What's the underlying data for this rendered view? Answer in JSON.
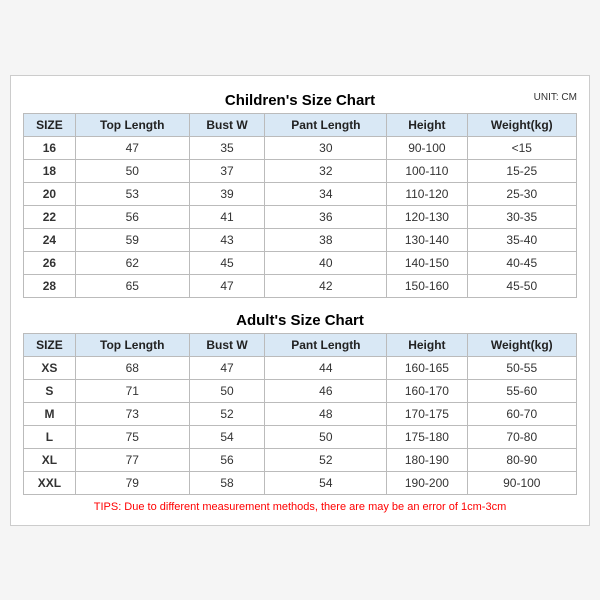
{
  "childrenChart": {
    "title": "Children's Size Chart",
    "unit": "UNIT: CM",
    "headers": [
      "SIZE",
      "Top Length",
      "Bust W",
      "Pant Length",
      "Height",
      "Weight(kg)"
    ],
    "rows": [
      [
        "16",
        "47",
        "35",
        "30",
        "90-100",
        "<15"
      ],
      [
        "18",
        "50",
        "37",
        "32",
        "100-110",
        "15-25"
      ],
      [
        "20",
        "53",
        "39",
        "34",
        "110-120",
        "25-30"
      ],
      [
        "22",
        "56",
        "41",
        "36",
        "120-130",
        "30-35"
      ],
      [
        "24",
        "59",
        "43",
        "38",
        "130-140",
        "35-40"
      ],
      [
        "26",
        "62",
        "45",
        "40",
        "140-150",
        "40-45"
      ],
      [
        "28",
        "65",
        "47",
        "42",
        "150-160",
        "45-50"
      ]
    ]
  },
  "adultChart": {
    "title": "Adult's Size Chart",
    "headers": [
      "SIZE",
      "Top Length",
      "Bust W",
      "Pant Length",
      "Height",
      "Weight(kg)"
    ],
    "rows": [
      [
        "XS",
        "68",
        "47",
        "44",
        "160-165",
        "50-55"
      ],
      [
        "S",
        "71",
        "50",
        "46",
        "160-170",
        "55-60"
      ],
      [
        "M",
        "73",
        "52",
        "48",
        "170-175",
        "60-70"
      ],
      [
        "L",
        "75",
        "54",
        "50",
        "175-180",
        "70-80"
      ],
      [
        "XL",
        "77",
        "56",
        "52",
        "180-190",
        "80-90"
      ],
      [
        "XXL",
        "79",
        "58",
        "54",
        "190-200",
        "90-100"
      ]
    ]
  },
  "tips": "TIPS: Due to different measurement methods, there are may be an error of 1cm-3cm"
}
